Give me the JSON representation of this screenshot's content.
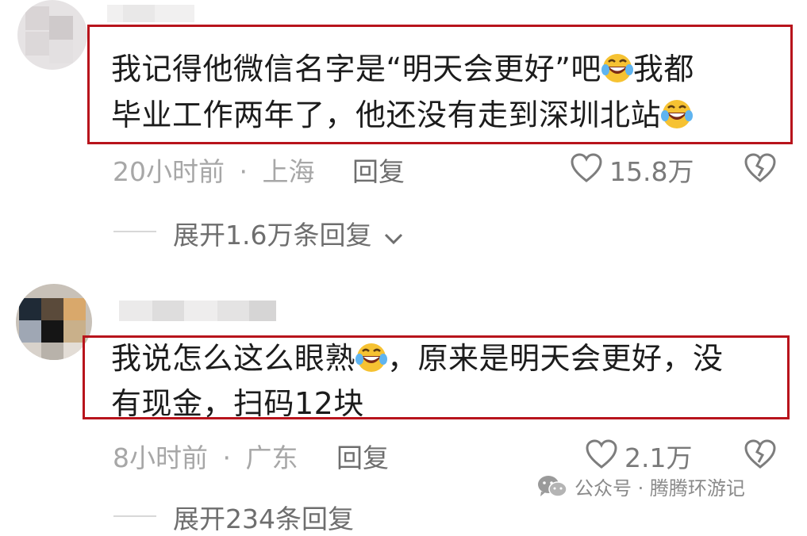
{
  "comments": [
    {
      "text_line1_a": "我记得他微信名字是“明天会更好”吧",
      "text_line1_b": "我都",
      "text_line2": "毕业工作两年了，他还没有走到深圳北站",
      "emoji": "rofl-emoji",
      "time": "20小时前",
      "sep": "·",
      "location": "上海",
      "reply_label": "回复",
      "likes": "15.8万",
      "expand_label": "展开1.6万条回复"
    },
    {
      "text_line1_a": "我说怎么这么眼熟",
      "text_line1_b": "，原来是明天会更好，没",
      "text_line2": "有现金，扫码12块",
      "emoji": "rofl-emoji",
      "time": "8小时前",
      "sep": "·",
      "location": "广东",
      "reply_label": "回复",
      "likes": "2.1万",
      "expand_label": "展开234条回复"
    }
  ],
  "watermark": {
    "text": "公众号 · 腾腾环游记",
    "icon": "wechat-icon"
  },
  "colors": {
    "highlight_border": "#b8141c",
    "meta": "#a7a7a7",
    "text": "#1c1c1c"
  }
}
